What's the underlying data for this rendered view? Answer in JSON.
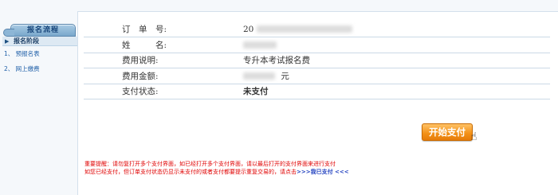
{
  "sidebar": {
    "tab_label": "报名流程",
    "section_label": "报名阶段",
    "items": [
      {
        "label": "1、 预报名表"
      },
      {
        "label": "2、 网上缴费"
      }
    ]
  },
  "order": {
    "rows": [
      {
        "label": "订　单　号:",
        "value": "20"
      },
      {
        "label": "姓　　　名:",
        "value": ""
      },
      {
        "label": "费用说明:",
        "value": "专升本考试报名费"
      },
      {
        "label": "费用金额:",
        "value": "元"
      },
      {
        "label": "支付状态:",
        "value": "未支付"
      }
    ]
  },
  "pay_button": {
    "label": "开始支付"
  },
  "notice": {
    "line1": "重要提醒：请勿复打开多个支付界面，如已经打开多个支付界面，请以最后打开的支付界面来进行支付",
    "line2_prefix": "如您已经支付，但订单支付状态仍显示未支付的或者支付都要提示重复交易的，请点击",
    "link_text": ">>>我已支付 <<<"
  },
  "colors": {
    "status_unpaid": "#e00000",
    "button_orange": "#f39016",
    "link_blue": "#1f3fbf"
  }
}
